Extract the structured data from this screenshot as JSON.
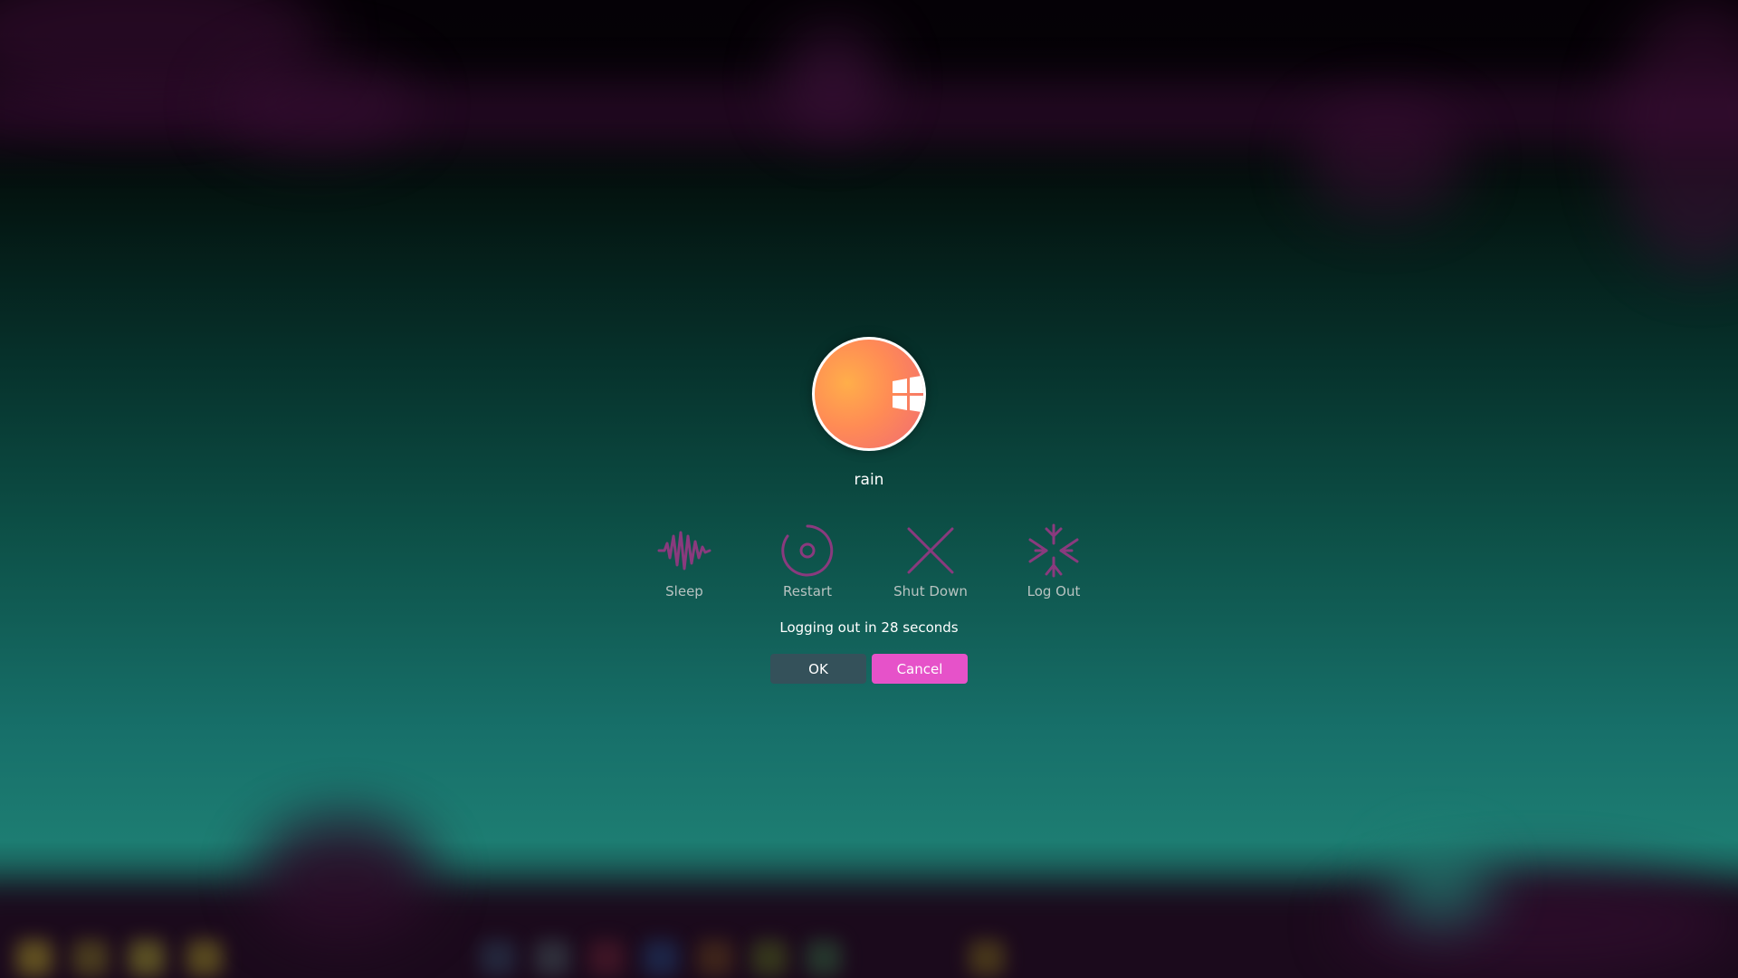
{
  "user": {
    "name": "rain",
    "avatar_icon": "windows-logo-icon"
  },
  "actions": [
    {
      "label": "Sleep",
      "icon": "sleep-wave-icon"
    },
    {
      "label": "Restart",
      "icon": "restart-icon"
    },
    {
      "label": "Shut Down",
      "icon": "shutdown-x-icon"
    },
    {
      "label": "Log Out",
      "icon": "logout-burst-icon"
    }
  ],
  "status": "Logging out in 28 seconds",
  "buttons": {
    "ok_label": "OK",
    "cancel_label": "Cancel"
  },
  "colors": {
    "icon_accent": "#8a3a7e",
    "cancel_button": "#e652c9",
    "ok_button": "#34515a"
  }
}
